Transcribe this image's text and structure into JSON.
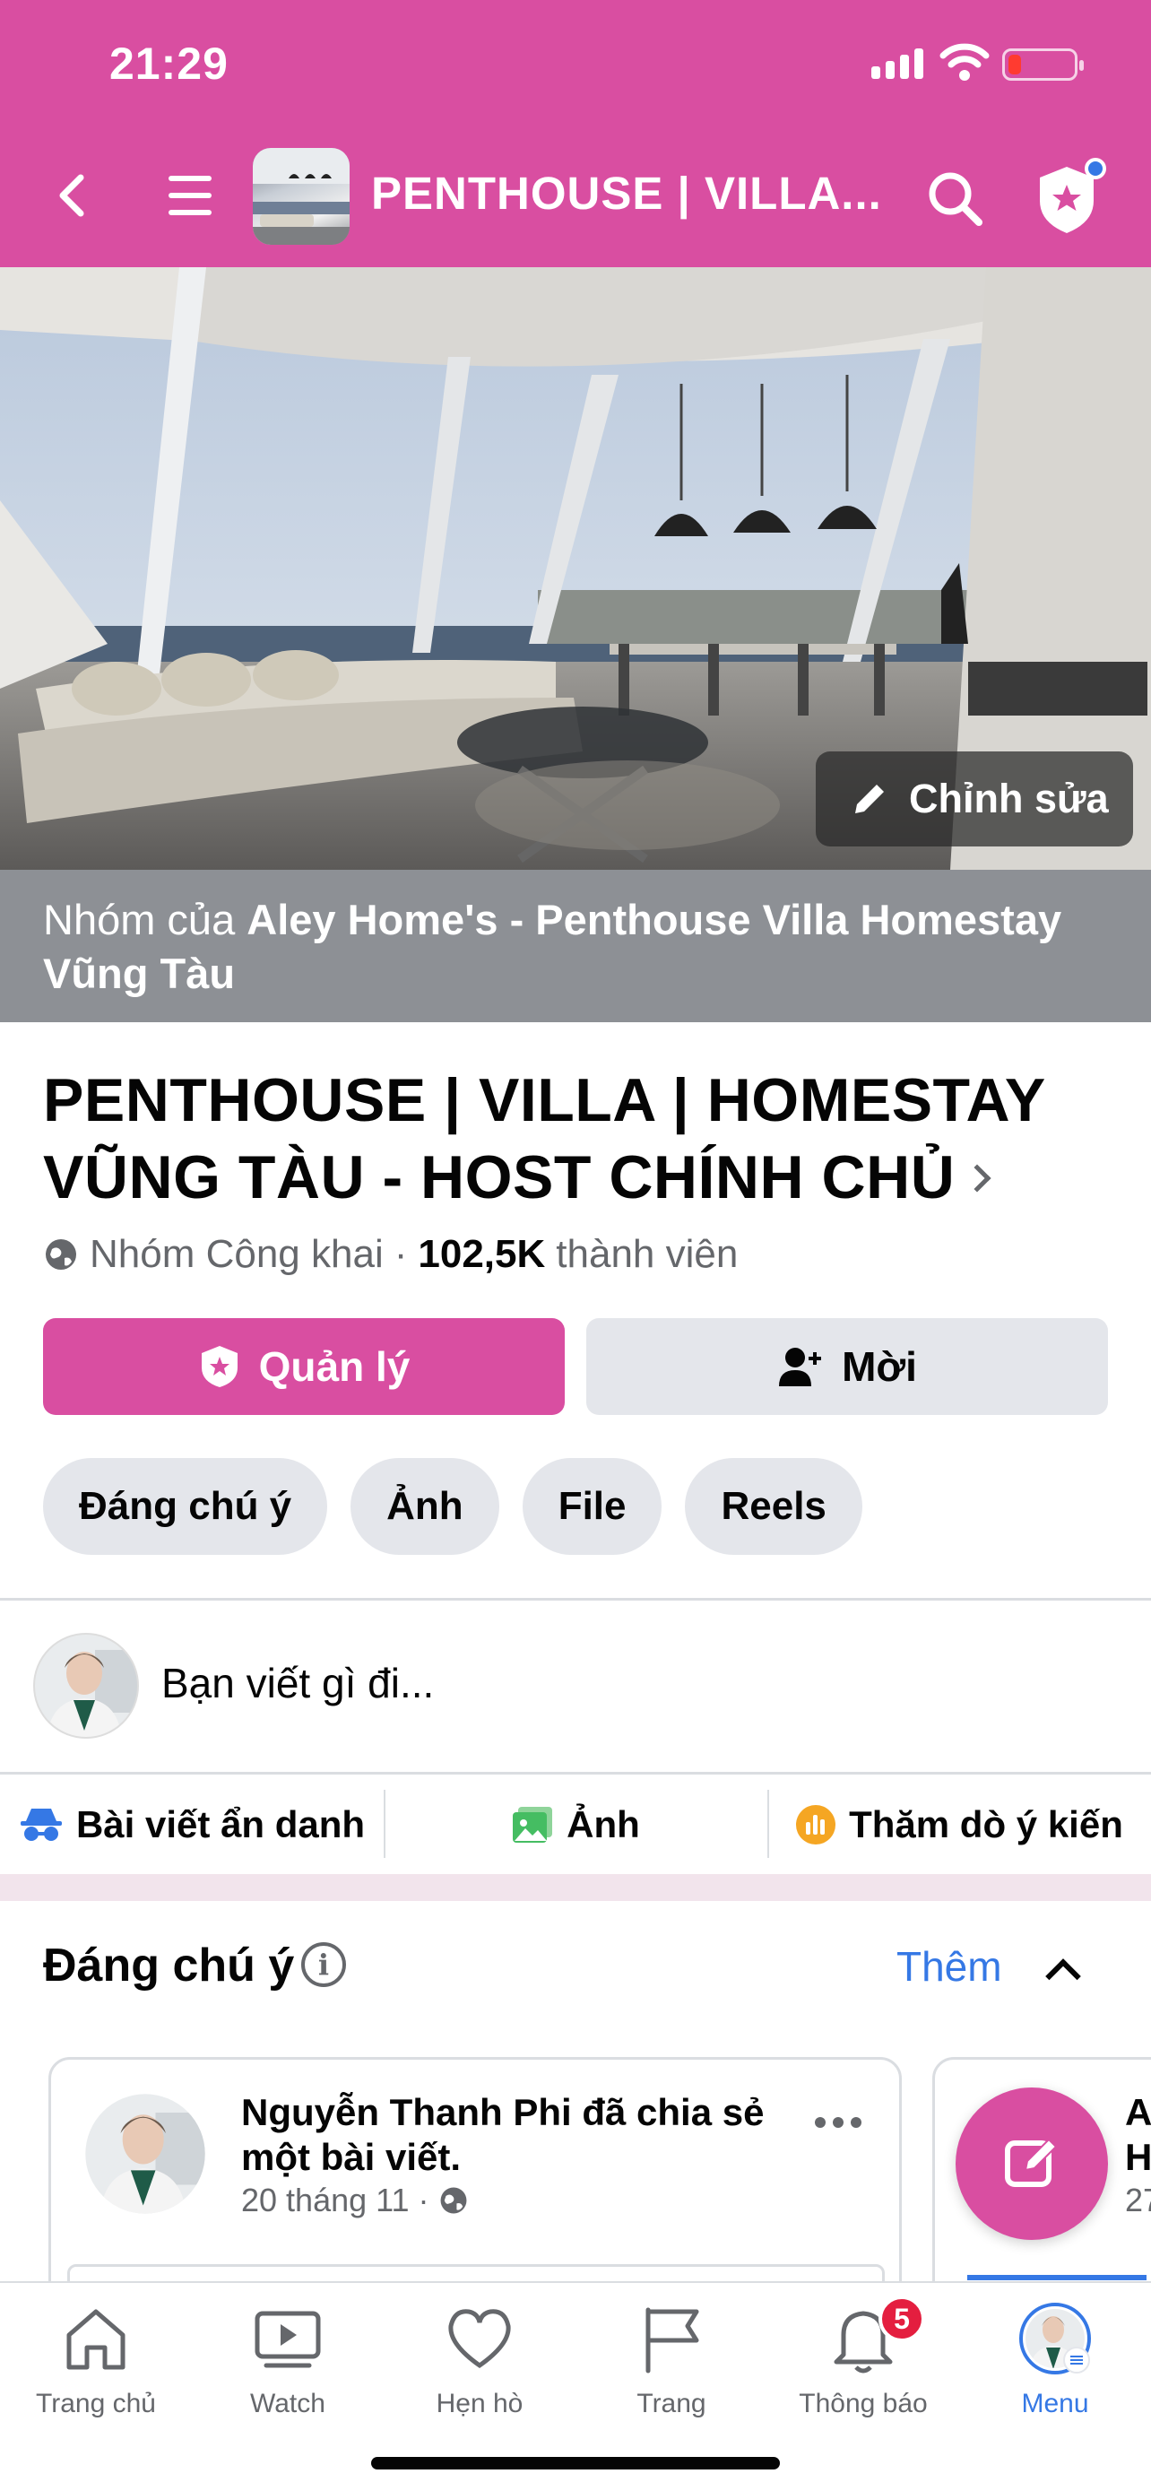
{
  "status": {
    "time": "21:29"
  },
  "header": {
    "title": "PENTHOUSE | VILLA..."
  },
  "cover": {
    "edit_label": "Chỉnh sửa"
  },
  "owner": {
    "prefix": "Nhóm của ",
    "name": "Aley Home's - Penthouse Villa Homestay Vũng Tàu"
  },
  "group": {
    "name_line1": "PENTHOUSE | VILLA | HOMESTAY",
    "name_line2": "VŨNG TÀU - HOST CHÍNH CHỦ",
    "privacy": "Nhóm Công khai",
    "dot": "·",
    "member_count": "102,5K",
    "member_label": "thành viên"
  },
  "buttons": {
    "manage": "Quản lý",
    "invite": "Mời"
  },
  "chips": [
    "Đáng chú ý",
    "Ảnh",
    "File",
    "Reels"
  ],
  "composer": {
    "prompt": "Bạn viết gì đi..."
  },
  "actions": {
    "anonymous": "Bài viết ẩn danh",
    "photo": "Ảnh",
    "poll": "Thăm dò ý kiến"
  },
  "featured": {
    "title": "Đáng chú ý",
    "info": "i",
    "more": "Thêm",
    "post": {
      "author": "Nguyễn Thanh Phi đã chia sẻ một bài viết.",
      "time": "20 tháng 11",
      "sep": "·"
    },
    "peek": {
      "line1": "A",
      "line2": "H",
      "time": "27"
    }
  },
  "tabbar": {
    "home": "Trang chủ",
    "watch": "Watch",
    "dating": "Hẹn hò",
    "pages": "Trang",
    "notifications": "Thông báo",
    "notifications_badge": "5",
    "menu": "Menu"
  },
  "colors": {
    "brand": "#d94ea1",
    "link": "#3578e5",
    "badge": "#e41e3f"
  }
}
